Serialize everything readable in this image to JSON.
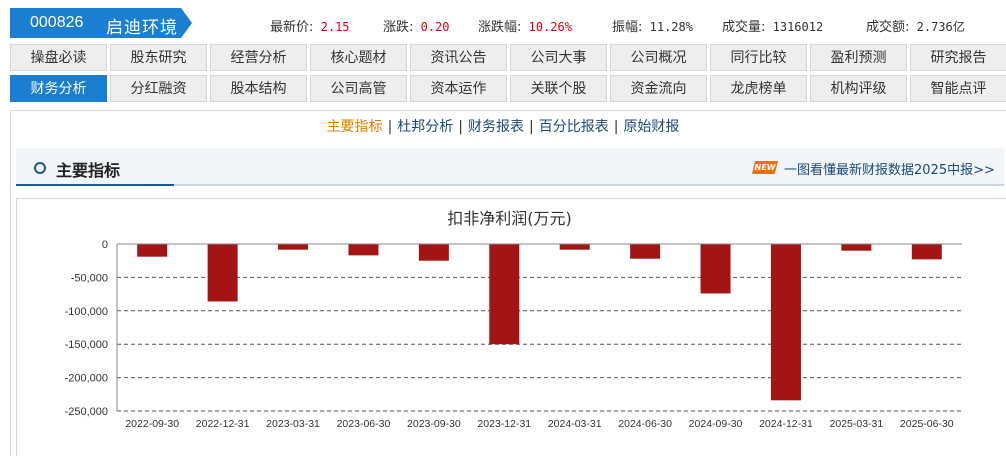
{
  "header": {
    "code": "000826",
    "name": "启迪环境",
    "quotes": [
      {
        "label": "最新价:",
        "value": "2.15",
        "red": true
      },
      {
        "label": "涨跌:",
        "value": "0.20",
        "red": true
      },
      {
        "label": "涨跌幅:",
        "value": "10.26%",
        "red": true
      },
      {
        "label": "振幅:",
        "value": "11.28%",
        "red": false
      },
      {
        "label": "成交量:",
        "value": "1316012",
        "red": false
      },
      {
        "label": "成交额:",
        "value": "2.736亿",
        "red": false
      }
    ]
  },
  "nav": {
    "row1": [
      "操盘必读",
      "股东研究",
      "经营分析",
      "核心题材",
      "资讯公告",
      "公司大事",
      "公司概况",
      "同行比较",
      "盈利预测",
      "研究报告"
    ],
    "row2": [
      "财务分析",
      "分红融资",
      "股本结构",
      "公司高管",
      "资本运作",
      "关联个股",
      "资金流向",
      "龙虎榜单",
      "机构评级",
      "智能点评"
    ],
    "active": "财务分析"
  },
  "subnav": {
    "links": [
      "主要指标",
      "杜邦分析",
      "财务报表",
      "百分比报表",
      "原始财报"
    ],
    "active": "主要指标",
    "separator": "|"
  },
  "section": {
    "title": "主要指标",
    "badge": "NEW",
    "promo": "一图看懂最新财报数据2025中报>>"
  },
  "colors": {
    "accent": "#1a7fd1",
    "bar": "#a31515",
    "price_red": "#e60012"
  },
  "chart_data": {
    "type": "bar",
    "title": "扣非净利润(万元)",
    "categories": [
      "2022-09-30",
      "2022-12-31",
      "2023-03-31",
      "2023-06-30",
      "2023-09-30",
      "2023-12-31",
      "2024-03-31",
      "2024-06-30",
      "2024-09-30",
      "2024-12-31",
      "2025-03-31",
      "2025-06-30"
    ],
    "values": [
      -19000,
      -86000,
      -8500,
      -17000,
      -25000,
      -150000,
      -8500,
      -22000,
      -74000,
      -234000,
      -10000,
      -23000
    ],
    "ylim": [
      -250000,
      0
    ],
    "yticks": [
      0,
      -50000,
      -100000,
      -150000,
      -200000,
      -250000
    ],
    "ytick_labels": [
      "0",
      "-50,000",
      "-100,000",
      "-150,000",
      "-200,000",
      "-250,000"
    ],
    "grid": true
  }
}
